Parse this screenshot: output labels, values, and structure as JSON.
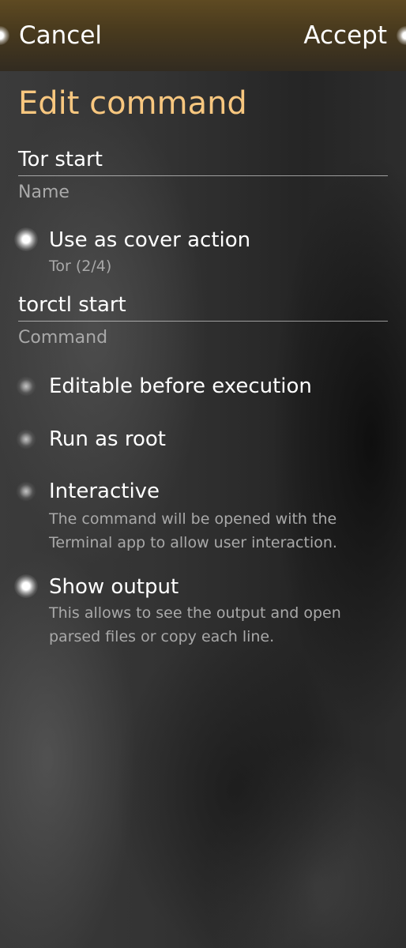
{
  "header": {
    "cancel_label": "Cancel",
    "accept_label": "Accept"
  },
  "page": {
    "title": "Edit command"
  },
  "name_field": {
    "value": "Tor start",
    "label": "Name"
  },
  "cover_switch": {
    "label": "Use as cover action",
    "description": "Tor (2/4)",
    "checked": true
  },
  "command_field": {
    "value": "torctl start",
    "label": "Command"
  },
  "editable_switch": {
    "label": "Editable before execution",
    "checked": false
  },
  "root_switch": {
    "label": "Run as root",
    "checked": false
  },
  "interactive_switch": {
    "label": "Interactive",
    "description": "The command will be opened with the Terminal app to allow user interaction.",
    "checked": false
  },
  "output_switch": {
    "label": "Show output",
    "description": "This allows to see the output and open parsed files or copy each line.",
    "checked": true
  },
  "colors": {
    "title_accent": "#f8c77f",
    "header_bg": "#4a3b1e",
    "secondary_text": "#a9a9a9"
  }
}
